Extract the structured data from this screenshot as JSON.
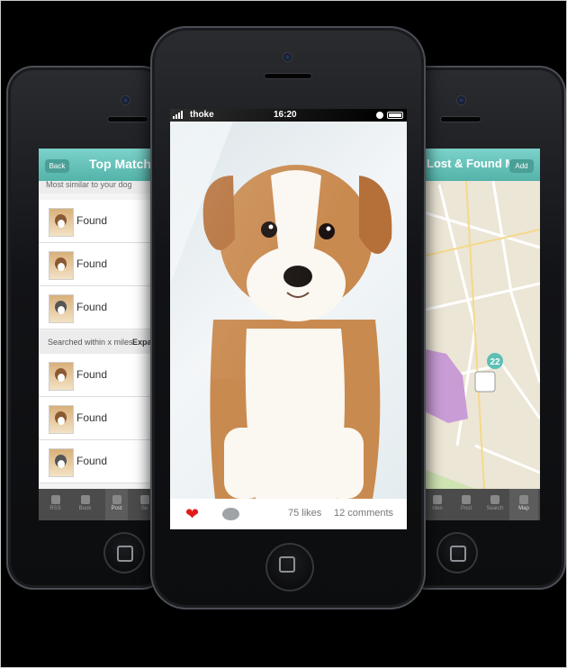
{
  "left_screen": {
    "back_label": "Back",
    "title": "Top Matches",
    "subtitle": "Most similar to your dog",
    "rows_top": [
      {
        "label": "Found"
      },
      {
        "label": "Found"
      },
      {
        "label": "Found"
      }
    ],
    "section_label": "Searched within x miles",
    "section_action": "Expa",
    "rows_bottom": [
      {
        "label": "Found"
      },
      {
        "label": "Found"
      },
      {
        "label": "Found"
      }
    ],
    "tabs": [
      {
        "label": "RSS",
        "icon": "rss-icon"
      },
      {
        "label": "Book",
        "icon": "book-icon"
      },
      {
        "label": "Post",
        "icon": "paw-icon",
        "active": true
      },
      {
        "label": "Se",
        "icon": "search-icon"
      }
    ]
  },
  "center_screen": {
    "status": {
      "carrier": "thoke",
      "time": "16:20"
    },
    "likes": "75 likes",
    "comments": "12 comments",
    "colors": {
      "heart": "#e01b1b"
    }
  },
  "right_screen": {
    "title": "Lost & Found Map",
    "add_label": "Add",
    "map_pin_count": "22",
    "tabs": [
      {
        "label": "rites",
        "icon": "star-icon"
      },
      {
        "label": "Post",
        "icon": "paw-icon"
      },
      {
        "label": "Search",
        "icon": "search-icon"
      },
      {
        "label": "Map",
        "icon": "map-pin-icon",
        "active": true
      }
    ]
  },
  "colors": {
    "accent": "#5dbfb6",
    "background": "#000000"
  }
}
